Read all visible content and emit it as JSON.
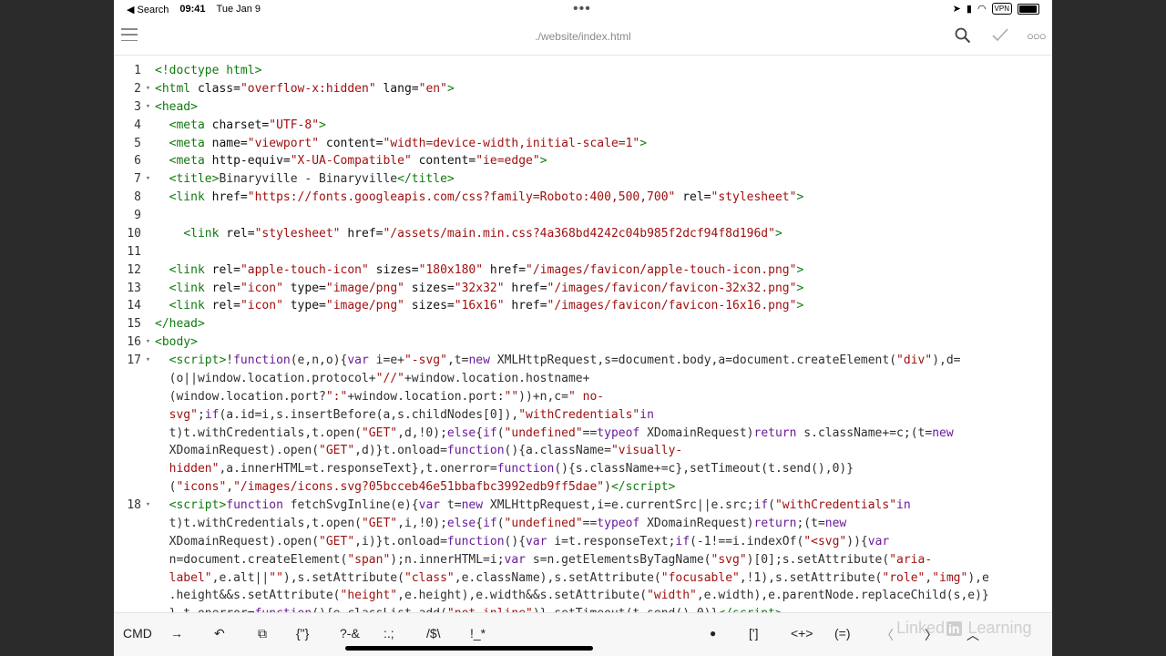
{
  "status": {
    "back": "◀ Search",
    "time": "09:41",
    "date": "Tue Jan 9",
    "vpn": "VPN"
  },
  "nav": {
    "title": "./website/index.html"
  },
  "code_lines": [
    {
      "n": "1",
      "fold": "",
      "html": "<span class=\"tag\">&lt;!doctype html&gt;</span>"
    },
    {
      "n": "2",
      "fold": "▾",
      "html": "<span class=\"tag\">&lt;html</span> <span class=\"attr\">class=</span><span class=\"str\">\"overflow-x:hidden\"</span> <span class=\"attr\">lang=</span><span class=\"str\">\"en\"</span><span class=\"tag\">&gt;</span>"
    },
    {
      "n": "3",
      "fold": "▾",
      "html": "<span class=\"tag\">&lt;head&gt;</span>"
    },
    {
      "n": "4",
      "fold": "",
      "html": "  <span class=\"tag\">&lt;meta</span> <span class=\"attr\">charset=</span><span class=\"str\">\"UTF-8\"</span><span class=\"tag\">&gt;</span>"
    },
    {
      "n": "5",
      "fold": "",
      "html": "  <span class=\"tag\">&lt;meta</span> <span class=\"attr\">name=</span><span class=\"str\">\"viewport\"</span> <span class=\"attr\">content=</span><span class=\"str\">\"width=device-width,initial-scale=1\"</span><span class=\"tag\">&gt;</span>"
    },
    {
      "n": "6",
      "fold": "",
      "html": "  <span class=\"tag\">&lt;meta</span> <span class=\"attr\">http-equiv=</span><span class=\"str\">\"X-UA-Compatible\"</span> <span class=\"attr\">content=</span><span class=\"str\">\"ie=edge\"</span><span class=\"tag\">&gt;</span>"
    },
    {
      "n": "7",
      "fold": "▾",
      "html": "  <span class=\"tag\">&lt;title&gt;</span>Binaryville - Binaryville<span class=\"tag\">&lt;/title&gt;</span>"
    },
    {
      "n": "8",
      "fold": "",
      "html": "  <span class=\"tag\">&lt;link</span> <span class=\"attr\">href=</span><span class=\"str\">\"https://fonts.googleapis.com/css?family=Roboto:400,500,700\"</span> <span class=\"attr\">rel=</span><span class=\"str\">\"stylesheet\"</span><span class=\"tag\">&gt;</span>"
    },
    {
      "n": "9",
      "fold": "",
      "html": ""
    },
    {
      "n": "10",
      "fold": "",
      "html": "    <span class=\"tag\">&lt;link</span> <span class=\"attr\">rel=</span><span class=\"str\">\"stylesheet\"</span> <span class=\"attr\">href=</span><span class=\"str\">\"/assets/main.min.css?4a368bd4242c04b985f2dcf94f8d196d\"</span><span class=\"tag\">&gt;</span>"
    },
    {
      "n": "11",
      "fold": "",
      "html": ""
    },
    {
      "n": "12",
      "fold": "",
      "html": "  <span class=\"tag\">&lt;link</span> <span class=\"attr\">rel=</span><span class=\"str\">\"apple-touch-icon\"</span> <span class=\"attr\">sizes=</span><span class=\"str\">\"180x180\"</span> <span class=\"attr\">href=</span><span class=\"str\">\"/images/favicon/apple-touch-icon.png\"</span><span class=\"tag\">&gt;</span>"
    },
    {
      "n": "13",
      "fold": "",
      "html": "  <span class=\"tag\">&lt;link</span> <span class=\"attr\">rel=</span><span class=\"str\">\"icon\"</span> <span class=\"attr\">type=</span><span class=\"str\">\"image/png\"</span> <span class=\"attr\">sizes=</span><span class=\"str\">\"32x32\"</span> <span class=\"attr\">href=</span><span class=\"str\">\"/images/favicon/favicon-32x32.png\"</span><span class=\"tag\">&gt;</span>"
    },
    {
      "n": "14",
      "fold": "",
      "html": "  <span class=\"tag\">&lt;link</span> <span class=\"attr\">rel=</span><span class=\"str\">\"icon\"</span> <span class=\"attr\">type=</span><span class=\"str\">\"image/png\"</span> <span class=\"attr\">sizes=</span><span class=\"str\">\"16x16\"</span> <span class=\"attr\">href=</span><span class=\"str\">\"/images/favicon/favicon-16x16.png\"</span><span class=\"tag\">&gt;</span>"
    },
    {
      "n": "15",
      "fold": "",
      "html": "<span class=\"tag\">&lt;/head&gt;</span>"
    },
    {
      "n": "16",
      "fold": "▾",
      "html": "<span class=\"tag\">&lt;body&gt;</span>"
    },
    {
      "n": "17",
      "fold": "▾",
      "html": "  <span class=\"tag\">&lt;script&gt;</span>!<span class=\"kw\">function</span>(e,n,o){<span class=\"kw\">var</span> i=e+<span class=\"str\">\"-svg\"</span>,t=<span class=\"kw\">new</span> XMLHttpRequest,s=document.body,a=document.createElement(<span class=\"str\">\"div\"</span>),d=\n  (o||window.location.protocol+<span class=\"str\">\"//\"</span>+window.location.hostname+\n  (window.location.port?<span class=\"str\">\":\"</span>+window.location.port:<span class=\"str\">\"\"</span>))+n,c=<span class=\"str\">\" no-\n  svg\"</span>;<span class=\"kw\">if</span>(a.id=i,s.insertBefore(a,s.childNodes[0]),<span class=\"str\">\"withCredentials\"</span><span class=\"kw\">in</span>\n  t)t.withCredentials,t.open(<span class=\"str\">\"GET\"</span>,d,!0);<span class=\"kw\">else</span>{<span class=\"kw\">if</span>(<span class=\"str\">\"undefined\"</span>==<span class=\"kw\">typeof</span> XDomainRequest)<span class=\"kw\">return</span> s.className+=c;(t=<span class=\"kw\">new</span>\n  XDomainRequest).open(<span class=\"str\">\"GET\"</span>,d)}t.onload=<span class=\"kw\">function</span>(){a.className=<span class=\"str\">\"visually-\n  hidden\"</span>,a.innerHTML=t.responseText},t.onerror=<span class=\"kw\">function</span>(){s.className+=c},setTimeout(t.send(),0)}\n  (<span class=\"str\">\"icons\"</span>,<span class=\"str\">\"/images/icons.svg?05bcceb46e51bbafbc3992edb9ff5dae\"</span>)<span class=\"tag\">&lt;/script&gt;</span>"
    },
    {
      "n": "18",
      "fold": "▾",
      "html": "  <span class=\"tag\">&lt;script&gt;</span><span class=\"kw\">function</span> fetchSvgInline(e){<span class=\"kw\">var</span> t=<span class=\"kw\">new</span> XMLHttpRequest,i=e.currentSrc||e.src;<span class=\"kw\">if</span>(<span class=\"str\">\"withCredentials\"</span><span class=\"kw\">in</span>\n  t)t.withCredentials,t.open(<span class=\"str\">\"GET\"</span>,i,!0);<span class=\"kw\">else</span>{<span class=\"kw\">if</span>(<span class=\"str\">\"undefined\"</span>==<span class=\"kw\">typeof</span> XDomainRequest)<span class=\"kw\">return</span>;(t=<span class=\"kw\">new</span>\n  XDomainRequest).open(<span class=\"str\">\"GET\"</span>,i)}t.onload=<span class=\"kw\">function</span>(){<span class=\"kw\">var</span> i=t.responseText;<span class=\"kw\">if</span>(-1!==i.indexOf(<span class=\"str\">\"&lt;svg\"</span>)){<span class=\"kw\">var</span>\n  n=document.createElement(<span class=\"str\">\"span\"</span>);n.innerHTML=i;<span class=\"kw\">var</span> s=n.getElementsByTagName(<span class=\"str\">\"svg\"</span>)[0];s.setAttribute(<span class=\"str\">\"aria-\n  label\"</span>,e.alt||<span class=\"str\">\"\"</span>),s.setAttribute(<span class=\"str\">\"class\"</span>,e.className),s.setAttribute(<span class=\"str\">\"focusable\"</span>,!1),s.setAttribute(<span class=\"str\">\"role\"</span>,<span class=\"str\">\"img\"</span>),e\n  .height&amp;&amp;s.setAttribute(<span class=\"str\">\"height\"</span>,e.height),e.width&amp;&amp;s.setAttribute(<span class=\"str\">\"width\"</span>,e.width),e.parentNode.replaceChild(s,e)}\n  },t.onerror=<span class=\"kw\">function</span>(){e.classList.add(<span class=\"str\">\"not-inline\"</span>)},setTimeout(t.send(),0)}<span class=\"tag\">&lt;/script&gt;</span>"
    }
  ],
  "toolbar": {
    "cmd": "CMD",
    "tab": "→",
    "undo": "↶",
    "copy": "⧉",
    "brace": "{\"}",
    "amp": "?-&",
    "semi": ":.;",
    "slash": "/$\\",
    "bang": "!_*",
    "dot": "●",
    "bracket": "[']",
    "arrows": "<+>",
    "paren": "(=)",
    "left": "〈",
    "right": "〉",
    "up": "︿"
  },
  "brand": {
    "pre": "Linked",
    "in": "in",
    "post": " Learning"
  }
}
